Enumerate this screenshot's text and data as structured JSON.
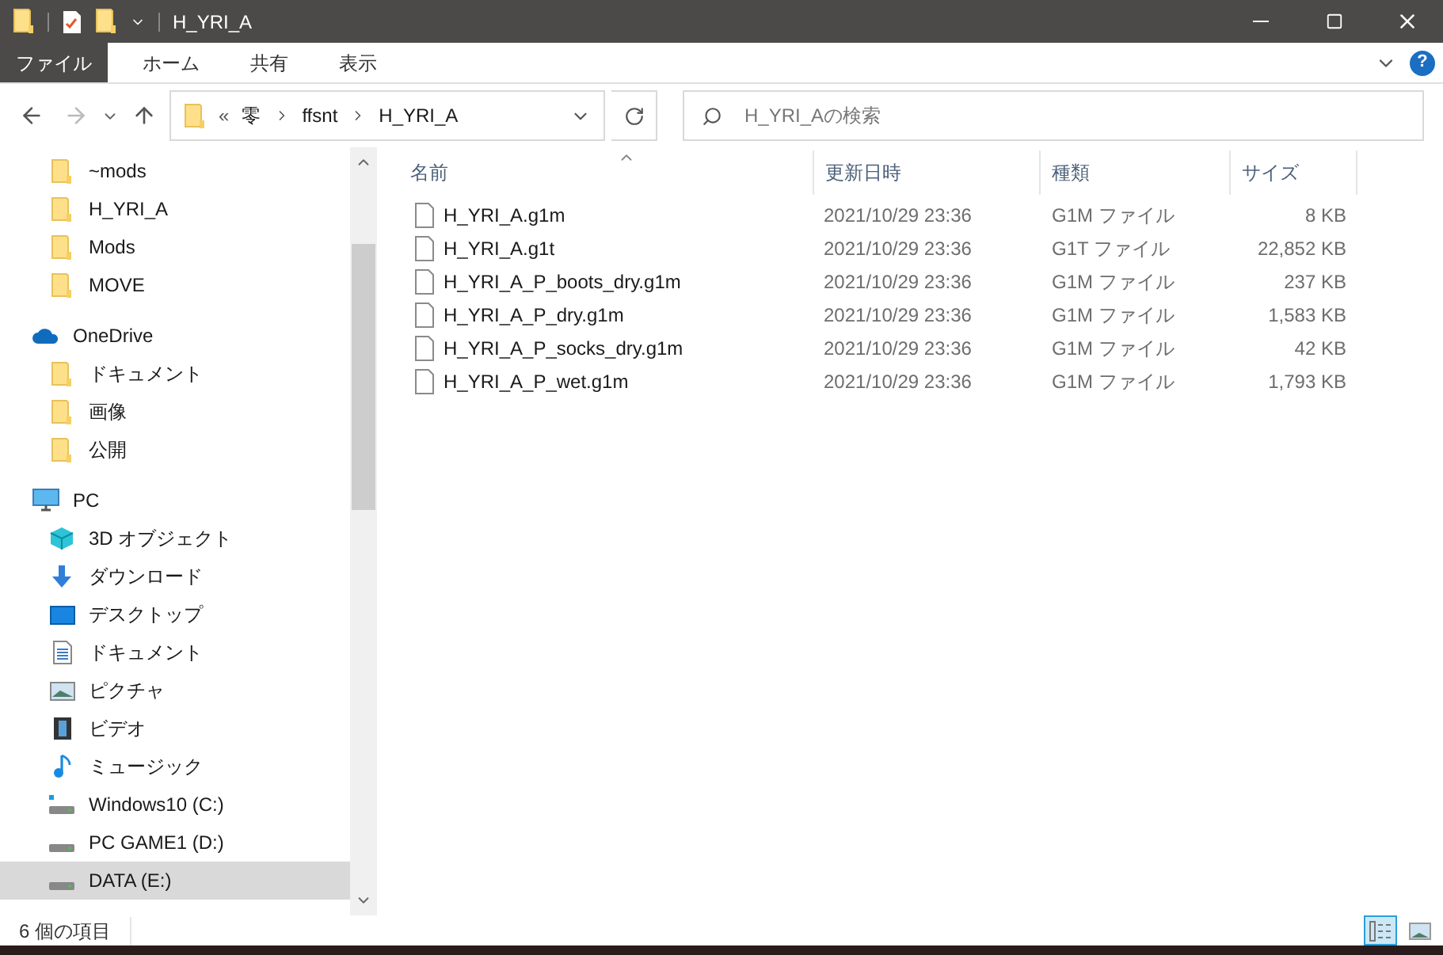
{
  "window": {
    "title": "H_YRI_A"
  },
  "ribbon": {
    "tabs": [
      {
        "label": "ファイル",
        "selected": true
      },
      {
        "label": "ホーム",
        "selected": false
      },
      {
        "label": "共有",
        "selected": false
      },
      {
        "label": "表示",
        "selected": false
      }
    ],
    "help": "?"
  },
  "address": {
    "overflow": "«",
    "crumbs": [
      "零",
      "ffsnt",
      "H_YRI_A"
    ]
  },
  "search": {
    "placeholder": "H_YRI_Aの検索"
  },
  "sidebar": {
    "items": [
      {
        "label": "~mods",
        "kind": "folder",
        "selected": false
      },
      {
        "label": "H_YRI_A",
        "kind": "folder",
        "selected": false
      },
      {
        "label": "Mods",
        "kind": "folder",
        "selected": false
      },
      {
        "label": "MOVE",
        "kind": "folder",
        "selected": false
      },
      {
        "label": "OneDrive",
        "kind": "cloud",
        "selected": false,
        "children": [
          {
            "label": "ドキュメント",
            "kind": "folder",
            "selected": false
          },
          {
            "label": "画像",
            "kind": "folder",
            "selected": false
          },
          {
            "label": "公開",
            "kind": "folder",
            "selected": false
          }
        ]
      },
      {
        "label": "PC",
        "kind": "pc",
        "selected": false,
        "children": [
          {
            "label": "3D オブジェクト",
            "kind": "cube",
            "selected": false
          },
          {
            "label": "ダウンロード",
            "kind": "download",
            "selected": false
          },
          {
            "label": "デスクトップ",
            "kind": "desktop",
            "selected": false
          },
          {
            "label": "ドキュメント",
            "kind": "document",
            "selected": false
          },
          {
            "label": "ピクチャ",
            "kind": "picture",
            "selected": false
          },
          {
            "label": "ビデオ",
            "kind": "video",
            "selected": false
          },
          {
            "label": "ミュージック",
            "kind": "music",
            "selected": false
          },
          {
            "label": "Windows10 (C:)",
            "kind": "windrive",
            "selected": false
          },
          {
            "label": "PC GAME1 (D:)",
            "kind": "drive",
            "selected": false
          },
          {
            "label": "DATA (E:)",
            "kind": "drive",
            "selected": true
          }
        ]
      }
    ]
  },
  "table": {
    "columns": [
      "名前",
      "更新日時",
      "種類",
      "サイズ"
    ],
    "rows": [
      [
        "H_YRI_A.g1m",
        "2021/10/29 23:36",
        "G1M ファイル",
        "8 KB"
      ],
      [
        "H_YRI_A.g1t",
        "2021/10/29 23:36",
        "G1T ファイル",
        "22,852 KB"
      ],
      [
        "H_YRI_A_P_boots_dry.g1m",
        "2021/10/29 23:36",
        "G1M ファイル",
        "237 KB"
      ],
      [
        "H_YRI_A_P_dry.g1m",
        "2021/10/29 23:36",
        "G1M ファイル",
        "1,583 KB"
      ],
      [
        "H_YRI_A_P_socks_dry.g1m",
        "2021/10/29 23:36",
        "G1M ファイル",
        "42 KB"
      ],
      [
        "H_YRI_A_P_wet.g1m",
        "2021/10/29 23:36",
        "G1M ファイル",
        "1,793 KB"
      ]
    ]
  },
  "status_bar": {
    "text": "6 個の項目",
    "views": [
      {
        "kind": "details",
        "selected": true
      },
      {
        "kind": "large",
        "selected": false
      }
    ]
  }
}
